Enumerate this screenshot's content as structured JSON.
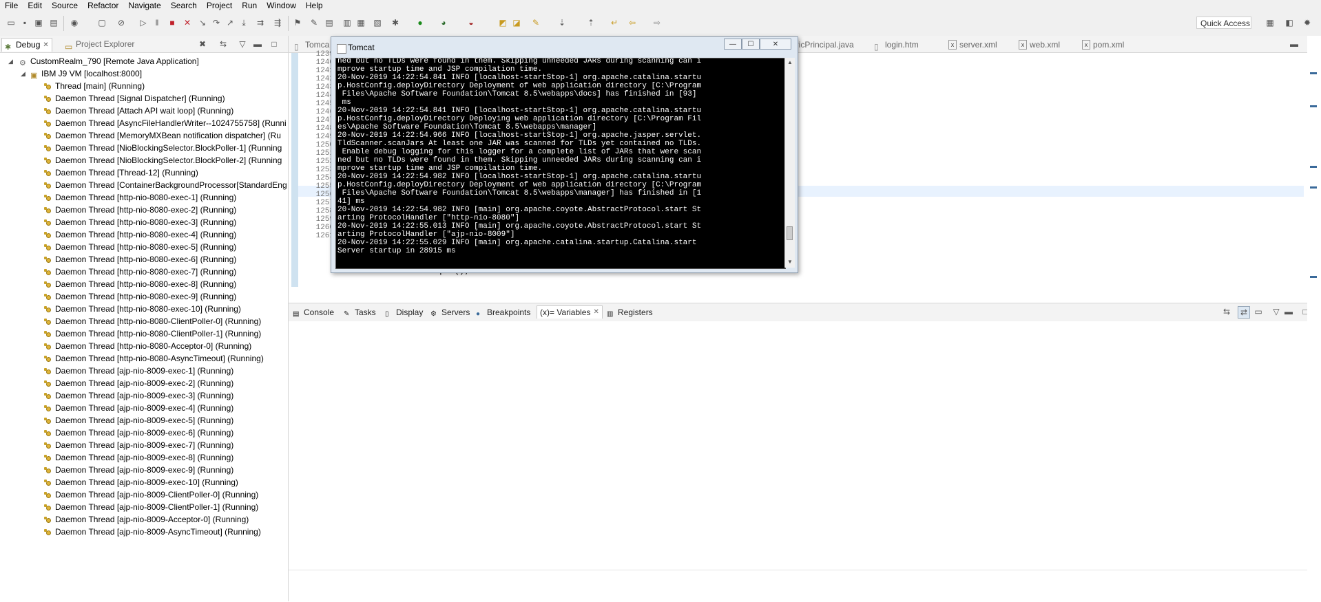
{
  "menubar": {
    "items": [
      "File",
      "Edit",
      "Source",
      "Refactor",
      "Navigate",
      "Search",
      "Project",
      "Run",
      "Window",
      "Help"
    ]
  },
  "toolbar": {
    "quick_access": "Quick Access"
  },
  "left_view": {
    "tabs": [
      {
        "label": "Debug",
        "active": true
      },
      {
        "label": "Project Explorer",
        "active": false
      }
    ],
    "launch": "CustomRealm_790 [Remote Java Application]",
    "vm": "IBM J9 VM [localhost:8000]",
    "threads": [
      "Thread [main] (Running)",
      "Daemon Thread [Signal Dispatcher] (Running)",
      "Daemon Thread [Attach API wait loop] (Running)",
      "Daemon Thread [AsyncFileHandlerWriter--1024755758] (Runni",
      "Daemon Thread [MemoryMXBean notification dispatcher] (Ru",
      "Daemon Thread [NioBlockingSelector.BlockPoller-1] (Running",
      "Daemon Thread [NioBlockingSelector.BlockPoller-2] (Running",
      "Daemon Thread [Thread-12] (Running)",
      "Daemon Thread [ContainerBackgroundProcessor[StandardEng",
      "Daemon Thread [http-nio-8080-exec-1] (Running)",
      "Daemon Thread [http-nio-8080-exec-2] (Running)",
      "Daemon Thread [http-nio-8080-exec-3] (Running)",
      "Daemon Thread [http-nio-8080-exec-4] (Running)",
      "Daemon Thread [http-nio-8080-exec-5] (Running)",
      "Daemon Thread [http-nio-8080-exec-6] (Running)",
      "Daemon Thread [http-nio-8080-exec-7] (Running)",
      "Daemon Thread [http-nio-8080-exec-8] (Running)",
      "Daemon Thread [http-nio-8080-exec-9] (Running)",
      "Daemon Thread [http-nio-8080-exec-10] (Running)",
      "Daemon Thread [http-nio-8080-ClientPoller-0] (Running)",
      "Daemon Thread [http-nio-8080-ClientPoller-1] (Running)",
      "Daemon Thread [http-nio-8080-Acceptor-0] (Running)",
      "Daemon Thread [http-nio-8080-AsyncTimeout] (Running)",
      "Daemon Thread [ajp-nio-8009-exec-1] (Running)",
      "Daemon Thread [ajp-nio-8009-exec-2] (Running)",
      "Daemon Thread [ajp-nio-8009-exec-3] (Running)",
      "Daemon Thread [ajp-nio-8009-exec-4] (Running)",
      "Daemon Thread [ajp-nio-8009-exec-5] (Running)",
      "Daemon Thread [ajp-nio-8009-exec-6] (Running)",
      "Daemon Thread [ajp-nio-8009-exec-7] (Running)",
      "Daemon Thread [ajp-nio-8009-exec-8] (Running)",
      "Daemon Thread [ajp-nio-8009-exec-9] (Running)",
      "Daemon Thread [ajp-nio-8009-exec-10] (Running)",
      "Daemon Thread [ajp-nio-8009-ClientPoller-0] (Running)",
      "Daemon Thread [ajp-nio-8009-ClientPoller-1] (Running)",
      "Daemon Thread [ajp-nio-8009-Acceptor-0] (Running)",
      "Daemon Thread [ajp-nio-8009-AsyncTimeout] (Running)"
    ]
  },
  "editor": {
    "tabs": [
      "Tomca",
      "ericPrincipal.java",
      "login.htm",
      "server.xml",
      "web.xml",
      "pom.xml"
    ],
    "line_numbers": [
      "1239",
      "1240",
      "1241",
      "1242",
      "1243",
      "1244",
      "1245",
      "1246",
      "1247",
      "1248",
      "1249",
      "1250",
      "1251",
      "1252",
      "1253",
      "1254",
      "1255",
      "1256",
      "1257",
      "1258",
      "1259",
      "1260",
      "1261"
    ],
    "visible_code": "context = open();"
  },
  "bottom": {
    "tabs": [
      {
        "label": "Console",
        "active": false
      },
      {
        "label": "Tasks",
        "active": false
      },
      {
        "label": "Display",
        "active": false
      },
      {
        "label": "Servers",
        "active": false
      },
      {
        "label": "Breakpoints",
        "active": false
      },
      {
        "label": "(x)= Variables",
        "active": true
      },
      {
        "label": "Registers",
        "active": false
      }
    ]
  },
  "tomcat_window": {
    "title": "Tomcat",
    "buttons": {
      "minimize": "—",
      "maximize": "☐",
      "close": "✕"
    },
    "console_lines": [
      "ned but no TLDs were found in them. Skipping unneeded JARs during scanning can i",
      "mprove startup time and JSP compilation time.",
      "20-Nov-2019 14:22:54.841 INFO [localhost-startStop-1] org.apache.catalina.startu",
      "p.HostConfig.deployDirectory Deployment of web application directory [C:\\Program",
      " Files\\Apache Software Foundation\\Tomcat 8.5\\webapps\\docs] has finished in [93]",
      " ms",
      "20-Nov-2019 14:22:54.841 INFO [localhost-startStop-1] org.apache.catalina.startu",
      "p.HostConfig.deployDirectory Deploying web application directory [C:\\Program Fil",
      "es\\Apache Software Foundation\\Tomcat 8.5\\webapps\\manager]",
      "20-Nov-2019 14:22:54.966 INFO [localhost-startStop-1] org.apache.jasper.servlet.",
      "TldScanner.scanJars At least one JAR was scanned for TLDs yet contained no TLDs.",
      " Enable debug logging for this logger for a complete list of JARs that were scan",
      "ned but no TLDs were found in them. Skipping unneeded JARs during scanning can i",
      "mprove startup time and JSP compilation time.",
      "20-Nov-2019 14:22:54.982 INFO [localhost-startStop-1] org.apache.catalina.startu",
      "p.HostConfig.deployDirectory Deployment of web application directory [C:\\Program",
      " Files\\Apache Software Foundation\\Tomcat 8.5\\webapps\\manager] has finished in [1",
      "41] ms",
      "20-Nov-2019 14:22:54.982 INFO [main] org.apache.coyote.AbstractProtocol.start St",
      "arting ProtocolHandler [\"http-nio-8080\"]",
      "20-Nov-2019 14:22:55.013 INFO [main] org.apache.coyote.AbstractProtocol.start St",
      "arting ProtocolHandler [\"ajp-nio-8009\"]",
      "20-Nov-2019 14:22:55.029 INFO [main] org.apache.catalina.startup.Catalina.start",
      "Server startup in 28915 ms"
    ]
  },
  "colors": {
    "console_bg": "#000000",
    "console_fg": "#ffffff",
    "thread_icon": "#e0b53a",
    "highlight_line": "#e8f2fe"
  }
}
